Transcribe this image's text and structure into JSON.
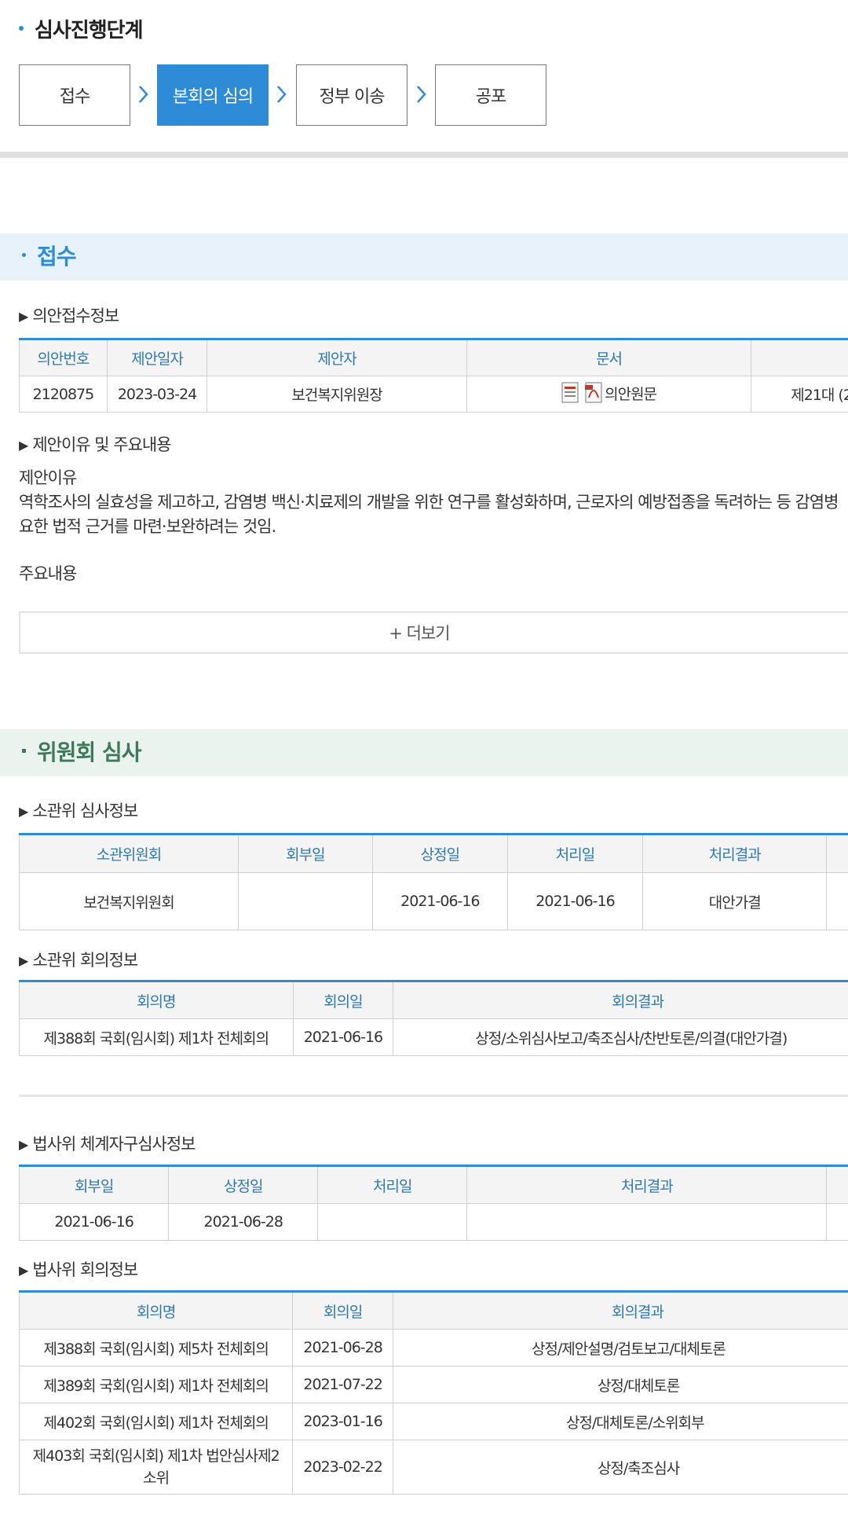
{
  "progress": {
    "title": "심사진행단계",
    "steps": [
      "접수",
      "본회의 심의",
      "정부 이송",
      "공포"
    ],
    "active_index": 1
  },
  "section_receipt": {
    "title": "접수",
    "info_heading": "의안접수정보",
    "columns": [
      "의안번호",
      "제안일자",
      "제안자",
      "문서",
      ""
    ],
    "row": {
      "bill_no": "2120875",
      "date": "2023-03-24",
      "proposer": "보건복지위원장",
      "document": "의안원문",
      "session": "제21대 (2"
    },
    "reason_heading": "제안이유 및 주요내용",
    "reason_label": "제안이유",
    "reason_line1": "역학조사의 실효성을 제고하고, 감염병 백신·치료제의 개발을 위한 연구를 활성화하며, 근로자의 예방접종을 독려하는 등 감염병",
    "reason_line2": "요한 법적 근거를 마련·보완하려는 것임.",
    "main_label": "주요내용",
    "more_button": "+ 더보기"
  },
  "section_committee": {
    "title": "위원회 심사",
    "review_heading": "소관위 심사정보",
    "review_columns": [
      "소관위원회",
      "회부일",
      "상정일",
      "처리일",
      "처리결과",
      ""
    ],
    "review_row": [
      "보건복지위원회",
      "",
      "2021-06-16",
      "2021-06-16",
      "대안가결",
      ""
    ],
    "meeting_heading": "소관위 회의정보",
    "meeting_columns": [
      "회의명",
      "회의일",
      "회의결과"
    ],
    "meeting_rows": [
      [
        "제388회 국회(임시회) 제1차 전체회의",
        "2021-06-16",
        "상정/소위심사보고/축조심사/찬반토론/의결(대안가결)"
      ]
    ],
    "judiciary_heading": "법사위 체계자구심사정보",
    "judiciary_columns": [
      "회부일",
      "상정일",
      "처리일",
      "처리결과",
      ""
    ],
    "judiciary_row": [
      "2021-06-16",
      "2021-06-28",
      "",
      "",
      ""
    ],
    "judiciary_meeting_heading": "법사위 회의정보",
    "judiciary_meeting_columns": [
      "회의명",
      "회의일",
      "회의결과"
    ],
    "judiciary_meeting_rows": [
      [
        "제388회 국회(임시회) 제5차 전체회의",
        "2021-06-28",
        "상정/제안설명/검토보고/대체토론"
      ],
      [
        "제389회 국회(임시회) 제1차 전체회의",
        "2021-07-22",
        "상정/대체토론"
      ],
      [
        "제402회 국회(임시회) 제1차 전체회의",
        "2023-01-16",
        "상정/대체토론/소위회부"
      ],
      [
        "제403회 국회(임시회) 제1차 법안심사제2소위",
        "2023-02-22",
        "상정/축조심사"
      ]
    ]
  },
  "colors": {
    "accent": "#2e8bd8",
    "committee": "#3d7a5a",
    "header_text": "#2e79b5"
  }
}
